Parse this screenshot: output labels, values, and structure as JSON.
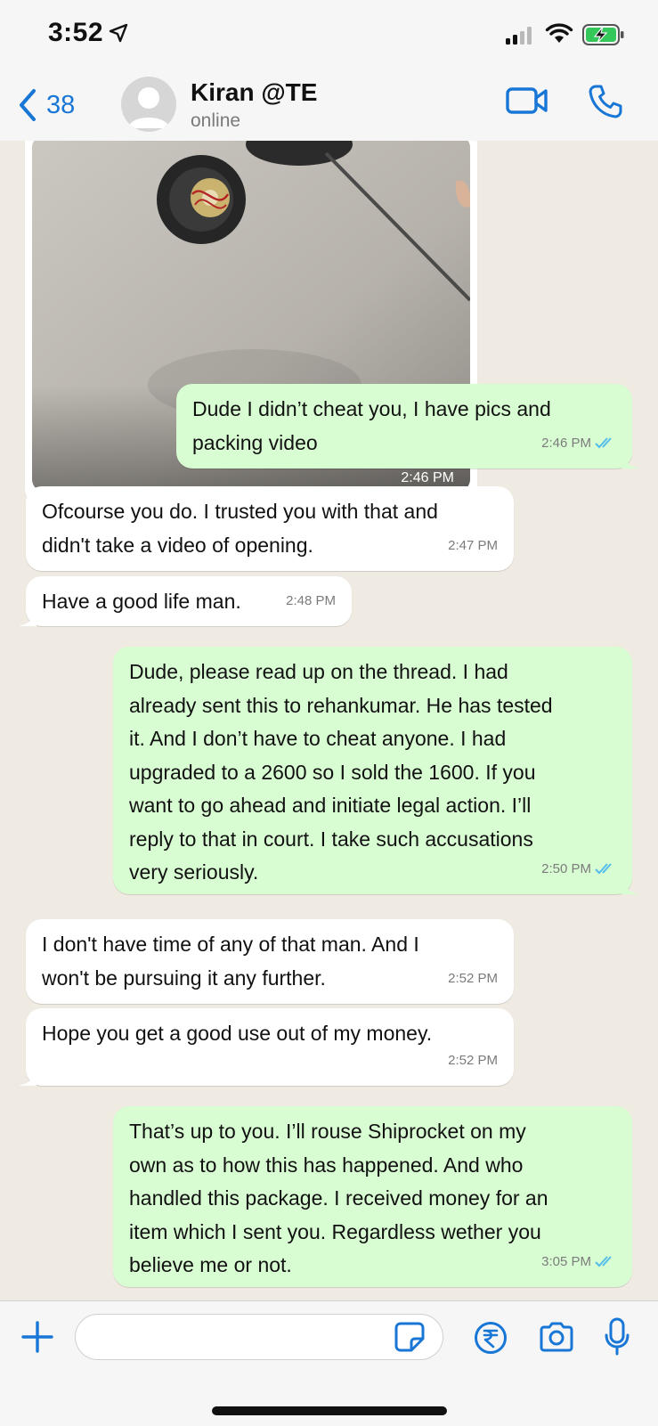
{
  "status_bar": {
    "time": "3:52",
    "icons": [
      "location-arrow-icon",
      "cellular-signal-icon",
      "wifi-icon",
      "battery-charging-icon"
    ],
    "battery_color": "#34c759"
  },
  "header": {
    "back_count": "38",
    "contact_name": "Kiran @TE",
    "contact_status": "online",
    "accent_color": "#1877d6"
  },
  "messages": [
    {
      "direction": "incoming",
      "type": "image",
      "time": "2:46 PM"
    },
    {
      "direction": "outgoing",
      "text": "Dude I didn’t cheat you, I have pics and\npacking video",
      "time": "2:46 PM",
      "read": true
    },
    {
      "direction": "incoming",
      "text": "Ofcourse you do. I trusted you with that and\ndidn't take a video of opening.",
      "time": "2:47 PM"
    },
    {
      "direction": "incoming",
      "text": "Have a good life man.",
      "time": "2:48 PM"
    },
    {
      "direction": "outgoing",
      "text": "Dude, please read up on the thread. I had\nalready sent this to rehankumar. He has tested\nit. And I don’t have to cheat anyone. I had\nupgraded to a 2600 so I sold the 1600. If you\nwant to go ahead and initiate legal action. I’ll\nreply to that in court. I take such accusations\nvery seriously.",
      "time": "2:50 PM",
      "read": true
    },
    {
      "direction": "incoming",
      "text": "I don't have time of any of that man. And I\nwon't be pursuing it any further.",
      "time": "2:52 PM"
    },
    {
      "direction": "incoming",
      "text": "Hope you get a good use out of my money.",
      "time": "2:52 PM"
    },
    {
      "direction": "outgoing",
      "text": "That’s up to you. I’ll rouse Shiprocket on my\nown as to how this has happened. And who\nhandled this package. I received money for an\nitem which I sent you. Regardless wether you\nbelieve me or not.",
      "time": "3:05 PM",
      "read": true
    }
  ],
  "input_bar": {
    "value": "",
    "icons": [
      "plus-icon",
      "sticker-icon",
      "rupee-payment-icon",
      "camera-icon",
      "microphone-icon"
    ]
  },
  "colors": {
    "chat_background": "#efeae2",
    "incoming_bubble": "#ffffff",
    "outgoing_bubble": "#d9fdd3",
    "read_ticks": "#53bdeb"
  }
}
